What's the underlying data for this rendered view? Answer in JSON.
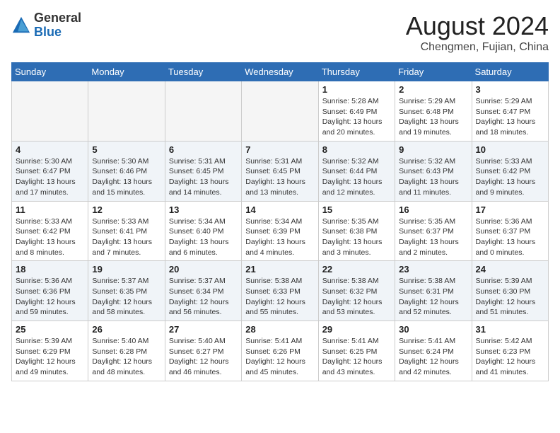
{
  "header": {
    "logo": {
      "general": "General",
      "blue": "Blue"
    },
    "title": "August 2024",
    "subtitle": "Chengmen, Fujian, China"
  },
  "weekdays": [
    "Sunday",
    "Monday",
    "Tuesday",
    "Wednesday",
    "Thursday",
    "Friday",
    "Saturday"
  ],
  "weeks": [
    [
      {
        "day": "",
        "info": ""
      },
      {
        "day": "",
        "info": ""
      },
      {
        "day": "",
        "info": ""
      },
      {
        "day": "",
        "info": ""
      },
      {
        "day": "1",
        "info": "Sunrise: 5:28 AM\nSunset: 6:49 PM\nDaylight: 13 hours\nand 20 minutes."
      },
      {
        "day": "2",
        "info": "Sunrise: 5:29 AM\nSunset: 6:48 PM\nDaylight: 13 hours\nand 19 minutes."
      },
      {
        "day": "3",
        "info": "Sunrise: 5:29 AM\nSunset: 6:47 PM\nDaylight: 13 hours\nand 18 minutes."
      }
    ],
    [
      {
        "day": "4",
        "info": "Sunrise: 5:30 AM\nSunset: 6:47 PM\nDaylight: 13 hours\nand 17 minutes."
      },
      {
        "day": "5",
        "info": "Sunrise: 5:30 AM\nSunset: 6:46 PM\nDaylight: 13 hours\nand 15 minutes."
      },
      {
        "day": "6",
        "info": "Sunrise: 5:31 AM\nSunset: 6:45 PM\nDaylight: 13 hours\nand 14 minutes."
      },
      {
        "day": "7",
        "info": "Sunrise: 5:31 AM\nSunset: 6:45 PM\nDaylight: 13 hours\nand 13 minutes."
      },
      {
        "day": "8",
        "info": "Sunrise: 5:32 AM\nSunset: 6:44 PM\nDaylight: 13 hours\nand 12 minutes."
      },
      {
        "day": "9",
        "info": "Sunrise: 5:32 AM\nSunset: 6:43 PM\nDaylight: 13 hours\nand 11 minutes."
      },
      {
        "day": "10",
        "info": "Sunrise: 5:33 AM\nSunset: 6:42 PM\nDaylight: 13 hours\nand 9 minutes."
      }
    ],
    [
      {
        "day": "11",
        "info": "Sunrise: 5:33 AM\nSunset: 6:42 PM\nDaylight: 13 hours\nand 8 minutes."
      },
      {
        "day": "12",
        "info": "Sunrise: 5:33 AM\nSunset: 6:41 PM\nDaylight: 13 hours\nand 7 minutes."
      },
      {
        "day": "13",
        "info": "Sunrise: 5:34 AM\nSunset: 6:40 PM\nDaylight: 13 hours\nand 6 minutes."
      },
      {
        "day": "14",
        "info": "Sunrise: 5:34 AM\nSunset: 6:39 PM\nDaylight: 13 hours\nand 4 minutes."
      },
      {
        "day": "15",
        "info": "Sunrise: 5:35 AM\nSunset: 6:38 PM\nDaylight: 13 hours\nand 3 minutes."
      },
      {
        "day": "16",
        "info": "Sunrise: 5:35 AM\nSunset: 6:37 PM\nDaylight: 13 hours\nand 2 minutes."
      },
      {
        "day": "17",
        "info": "Sunrise: 5:36 AM\nSunset: 6:37 PM\nDaylight: 13 hours\nand 0 minutes."
      }
    ],
    [
      {
        "day": "18",
        "info": "Sunrise: 5:36 AM\nSunset: 6:36 PM\nDaylight: 12 hours\nand 59 minutes."
      },
      {
        "day": "19",
        "info": "Sunrise: 5:37 AM\nSunset: 6:35 PM\nDaylight: 12 hours\nand 58 minutes."
      },
      {
        "day": "20",
        "info": "Sunrise: 5:37 AM\nSunset: 6:34 PM\nDaylight: 12 hours\nand 56 minutes."
      },
      {
        "day": "21",
        "info": "Sunrise: 5:38 AM\nSunset: 6:33 PM\nDaylight: 12 hours\nand 55 minutes."
      },
      {
        "day": "22",
        "info": "Sunrise: 5:38 AM\nSunset: 6:32 PM\nDaylight: 12 hours\nand 53 minutes."
      },
      {
        "day": "23",
        "info": "Sunrise: 5:38 AM\nSunset: 6:31 PM\nDaylight: 12 hours\nand 52 minutes."
      },
      {
        "day": "24",
        "info": "Sunrise: 5:39 AM\nSunset: 6:30 PM\nDaylight: 12 hours\nand 51 minutes."
      }
    ],
    [
      {
        "day": "25",
        "info": "Sunrise: 5:39 AM\nSunset: 6:29 PM\nDaylight: 12 hours\nand 49 minutes."
      },
      {
        "day": "26",
        "info": "Sunrise: 5:40 AM\nSunset: 6:28 PM\nDaylight: 12 hours\nand 48 minutes."
      },
      {
        "day": "27",
        "info": "Sunrise: 5:40 AM\nSunset: 6:27 PM\nDaylight: 12 hours\nand 46 minutes."
      },
      {
        "day": "28",
        "info": "Sunrise: 5:41 AM\nSunset: 6:26 PM\nDaylight: 12 hours\nand 45 minutes."
      },
      {
        "day": "29",
        "info": "Sunrise: 5:41 AM\nSunset: 6:25 PM\nDaylight: 12 hours\nand 43 minutes."
      },
      {
        "day": "30",
        "info": "Sunrise: 5:41 AM\nSunset: 6:24 PM\nDaylight: 12 hours\nand 42 minutes."
      },
      {
        "day": "31",
        "info": "Sunrise: 5:42 AM\nSunset: 6:23 PM\nDaylight: 12 hours\nand 41 minutes."
      }
    ]
  ]
}
